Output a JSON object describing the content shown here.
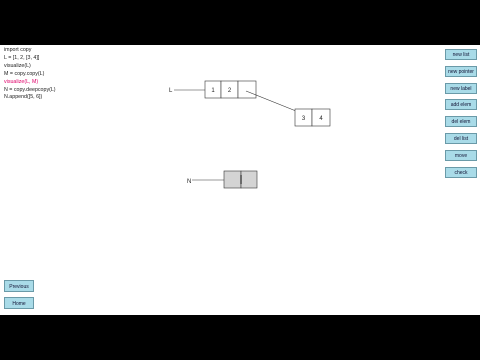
{
  "code_lines": [
    {
      "text": "import copy",
      "highlight": false
    },
    {
      "text": "L = [1, 2, [3, 4]]",
      "highlight": false
    },
    {
      "text": "visualize(L)",
      "highlight": false
    },
    {
      "text": "M = copy.copy(L)",
      "highlight": false
    },
    {
      "text": "visualize(L, M)",
      "highlight": true
    },
    {
      "text": "N = copy.deepcopy(L)",
      "highlight": false
    },
    {
      "text": "N.append([5, 6])",
      "highlight": false
    }
  ],
  "buttons": {
    "new_list": "new list",
    "new_pointer": "new pointer",
    "new_label": "new label",
    "add_elem": "add elem",
    "del_elem": "del elem",
    "del_list": "del list",
    "move": "move",
    "check": "check"
  },
  "nav": {
    "previous": "Previous",
    "home": "Home"
  },
  "diagram": {
    "pointer_L": "L",
    "pointer_N": "N",
    "list_L_cells": [
      "1",
      "2",
      ""
    ],
    "list_inner_cells": [
      "3",
      "4"
    ],
    "list_N_cells": [
      "",
      ""
    ]
  },
  "colors": {
    "button_bg": "#a9dbe8",
    "highlight": "#e0006a",
    "empty_list_fill": "#d4d4d4"
  }
}
